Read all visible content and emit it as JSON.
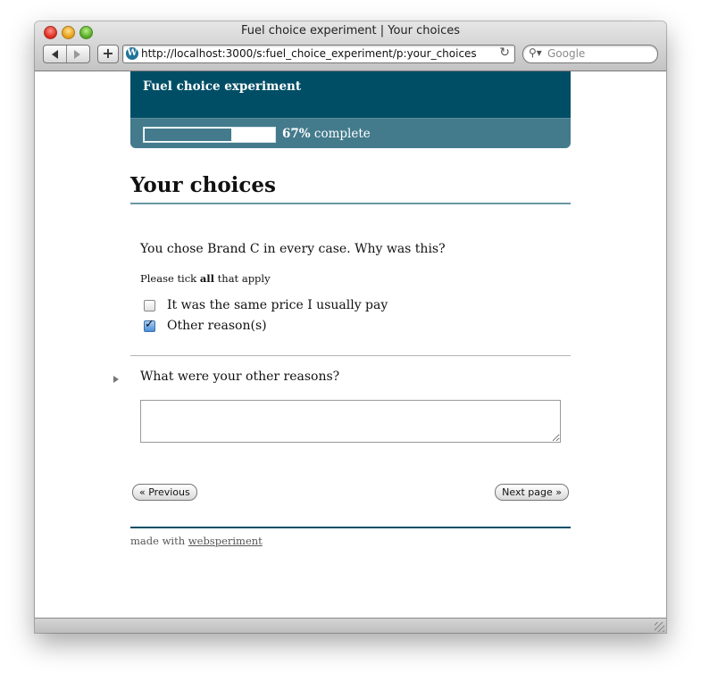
{
  "browser": {
    "window_title": "Fuel choice experiment | Your choices",
    "url": "http://localhost:3000/s:fuel_choice_experiment/p:your_choices",
    "site_icon_letter": "W",
    "add_label": "+",
    "reload_icon": "reload-icon",
    "search_placeholder": "Google"
  },
  "site": {
    "title": "Fuel choice experiment",
    "progress_percent": 67,
    "progress_label": "67%",
    "progress_suffix": " complete"
  },
  "page": {
    "heading": "Your choices",
    "question": "You chose Brand C in every case. Why was this?",
    "hint_prefix": "Please tick ",
    "hint_bold": "all",
    "hint_suffix": " that apply",
    "options": [
      {
        "label": "It was the same price I usually pay",
        "checked": false
      },
      {
        "label": "Other reason(s)",
        "checked": true
      }
    ],
    "followup_question": "What were your other reasons?",
    "followup_value": "",
    "prev_label": "« Previous",
    "next_label": "Next page »"
  },
  "footer": {
    "prefix": "made with ",
    "link": "websperiment"
  },
  "colors": {
    "header_bg": "#004e66",
    "progress_bg": "#437b8c"
  }
}
